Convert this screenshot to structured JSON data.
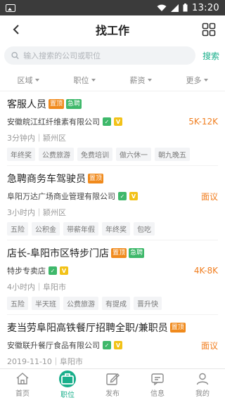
{
  "statusbar": {
    "time": "13:20"
  },
  "header": {
    "title": "找工作"
  },
  "search": {
    "placeholder": "输入搜索的公司或职位",
    "button_label": "搜索"
  },
  "filters": [
    {
      "label": "区域"
    },
    {
      "label": "职位"
    },
    {
      "label": "薪资"
    },
    {
      "label": "更多"
    }
  ],
  "jobs": [
    {
      "title": "客服人员",
      "badges": [
        "置顶",
        "急聘"
      ],
      "company": "安徽皖江红纤维素有限公司",
      "salary": "5K-12K",
      "meta": "3分钟内｜颍州区",
      "tags": [
        "年终奖",
        "公费旅游",
        "免费培训",
        "做六休一",
        "朝九晚五"
      ]
    },
    {
      "title": "急聘商务车驾驶员",
      "badges": [
        "置顶"
      ],
      "company": "阜阳万达广场商业管理有限公司",
      "salary": "面议",
      "meta": "3小时内｜颍州区",
      "tags": [
        "五险",
        "公积金",
        "带薪年假",
        "年终奖",
        "包吃"
      ]
    },
    {
      "title": "店长-阜阳市区特步门店",
      "badges": [
        "置顶",
        "急聘"
      ],
      "company": "特步专卖店",
      "salary": "4K-8K",
      "meta": "4小时内｜阜阳市",
      "tags": [
        "五险",
        "半天班",
        "公费旅游",
        "有提成",
        "晋升快"
      ]
    },
    {
      "title": "麦当劳阜阳高铁餐厅招聘全职/兼职员",
      "badges": [
        "置顶"
      ],
      "company": "安徽联升餐厅食品有限公司",
      "salary": "面议",
      "meta": "2019-11-10｜阜阳市",
      "tags": []
    }
  ],
  "tabbar": [
    {
      "label": "首页",
      "icon": "home-icon"
    },
    {
      "label": "职位",
      "icon": "briefcase-icon",
      "active": true
    },
    {
      "label": "发布",
      "icon": "edit-icon"
    },
    {
      "label": "信息",
      "icon": "message-icon"
    },
    {
      "label": "我的",
      "icon": "user-icon"
    }
  ],
  "colors": {
    "accent": "#1aaf8b",
    "salary": "#f07d1e",
    "top_badge": "#f08a1c",
    "urgent_badge": "#3eb86a"
  }
}
